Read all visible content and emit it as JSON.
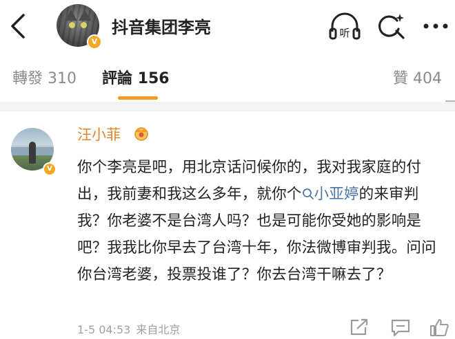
{
  "header": {
    "title": "抖音集团李亮",
    "verified_badge": "V",
    "listen_label": "听",
    "icons": [
      "back-arrow-icon",
      "listen-icon",
      "search-icon",
      "more-icon"
    ]
  },
  "tabs": [
    {
      "label": "轉發",
      "count": "310"
    },
    {
      "label": "評論",
      "count": "156",
      "active": true
    },
    {
      "label": "贊",
      "count": "404"
    }
  ],
  "comment": {
    "author": "汪小菲",
    "verified_badge": "V",
    "text_part1": "你个李亮是吧，用北京话问候你的，我对我家庭的付出，我前妻和我这么多年，就你个",
    "link_text": "小亚婷",
    "text_part2": "的来审判我？你老婆不是台湾人吗？也是可能你受她的影响是吧？我我比你早去了台湾十年，你法微博审判我。问问你台湾老婆，投票投谁了？你去台湾干嘛去了？",
    "time": "1-5 04:53",
    "source": "来自北京"
  },
  "colors": {
    "accent": "#f29b2a",
    "author_name": "#e4842a",
    "link": "#4a76a8",
    "muted": "#8a8a8a"
  }
}
